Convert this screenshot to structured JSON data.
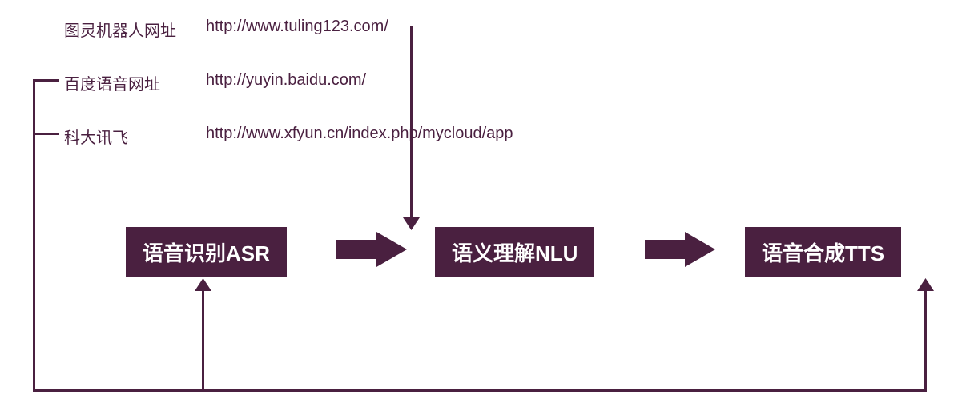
{
  "info": {
    "row1": {
      "label": "图灵机器人网址",
      "url": "http://www.tuling123.com/"
    },
    "row2": {
      "label": "百度语音网址",
      "url": "http://yuyin.baidu.com/"
    },
    "row3": {
      "label": "科大讯飞",
      "url": "http://www.xfyun.cn/index.php/mycloud/app"
    }
  },
  "boxes": {
    "asr": "语音识别ASR",
    "nlu": "语义理解NLU",
    "tts": "语音合成TTS"
  }
}
